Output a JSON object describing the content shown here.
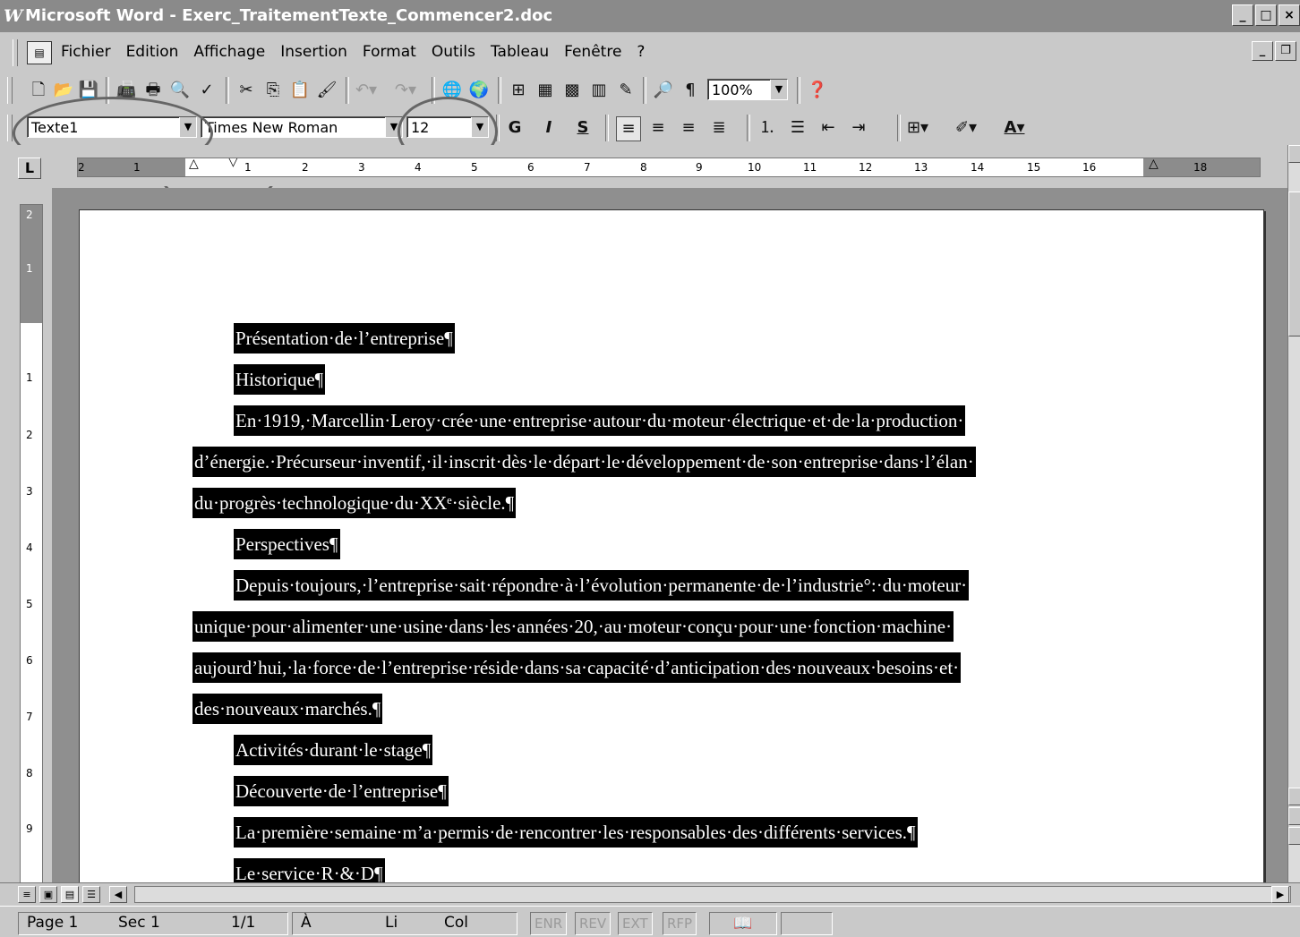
{
  "window": {
    "title": "Microsoft Word - Exerc_TraitementTexte_Commencer2.doc",
    "app_icon": "W"
  },
  "menu": {
    "items": [
      "Fichier",
      "Edition",
      "Affichage",
      "Insertion",
      "Format",
      "Outils",
      "Tableau",
      "Fenêtre",
      "?"
    ]
  },
  "toolbar": {
    "zoom": "100%",
    "style": "Texte1",
    "font": "Times New Roman",
    "size": "12",
    "bold_label": "G",
    "italic_label": "I",
    "underline_label": "S"
  },
  "ruler": {
    "labels": [
      "2",
      "1",
      "1",
      "2",
      "3",
      "4",
      "5",
      "6",
      "7",
      "8",
      "9",
      "10",
      "11",
      "12",
      "13",
      "14",
      "15",
      "16",
      "18"
    ]
  },
  "vruler": {
    "labels": [
      "2",
      "1",
      "1",
      "2",
      "3",
      "4",
      "5",
      "6",
      "7",
      "8",
      "9"
    ]
  },
  "document": {
    "paragraphs": [
      "Présentation·de·l’entreprise¶",
      "Historique¶",
      "En·1919,·Marcellin·Leroy·crée·une·entreprise·autour·du·moteur·électrique·et·de·la·production·",
      "d’énergie.·Précurseur·inventif,·il·inscrit·dès·le·départ·le·développement·de·son·entreprise·dans·l’élan·",
      "du·progrès·technologique·du·XXᵉ·siècle.¶",
      "Perspectives¶",
      "Depuis·toujours,·l’entreprise·sait·répondre·à·l’évolution·permanente·de·l’industrie°:·du·moteur·",
      "unique·pour·alimenter·une·usine·dans·les·années·20,·au·moteur·conçu·pour·une·fonction·machine·",
      "aujourd’hui,·la·force·de·l’entreprise·réside·dans·sa·capacité·d’anticipation·des·nouveaux·besoins·et·",
      "des·nouveaux·marchés.¶",
      "Activités·durant·le·stage¶",
      "Découverte·de·l’entreprise¶",
      "La·première·semaine·m’a·permis·de·rencontrer·les·responsables·des·différents·services.¶",
      "Le·service·R·&·D¶"
    ]
  },
  "status": {
    "page": "Page 1",
    "sec": "Sec 1",
    "pages": "1/1",
    "at": "À",
    "line": "Li",
    "col": "Col",
    "enr": "ENR",
    "rev": "REV",
    "ext": "EXT",
    "rfp": "RFP"
  }
}
